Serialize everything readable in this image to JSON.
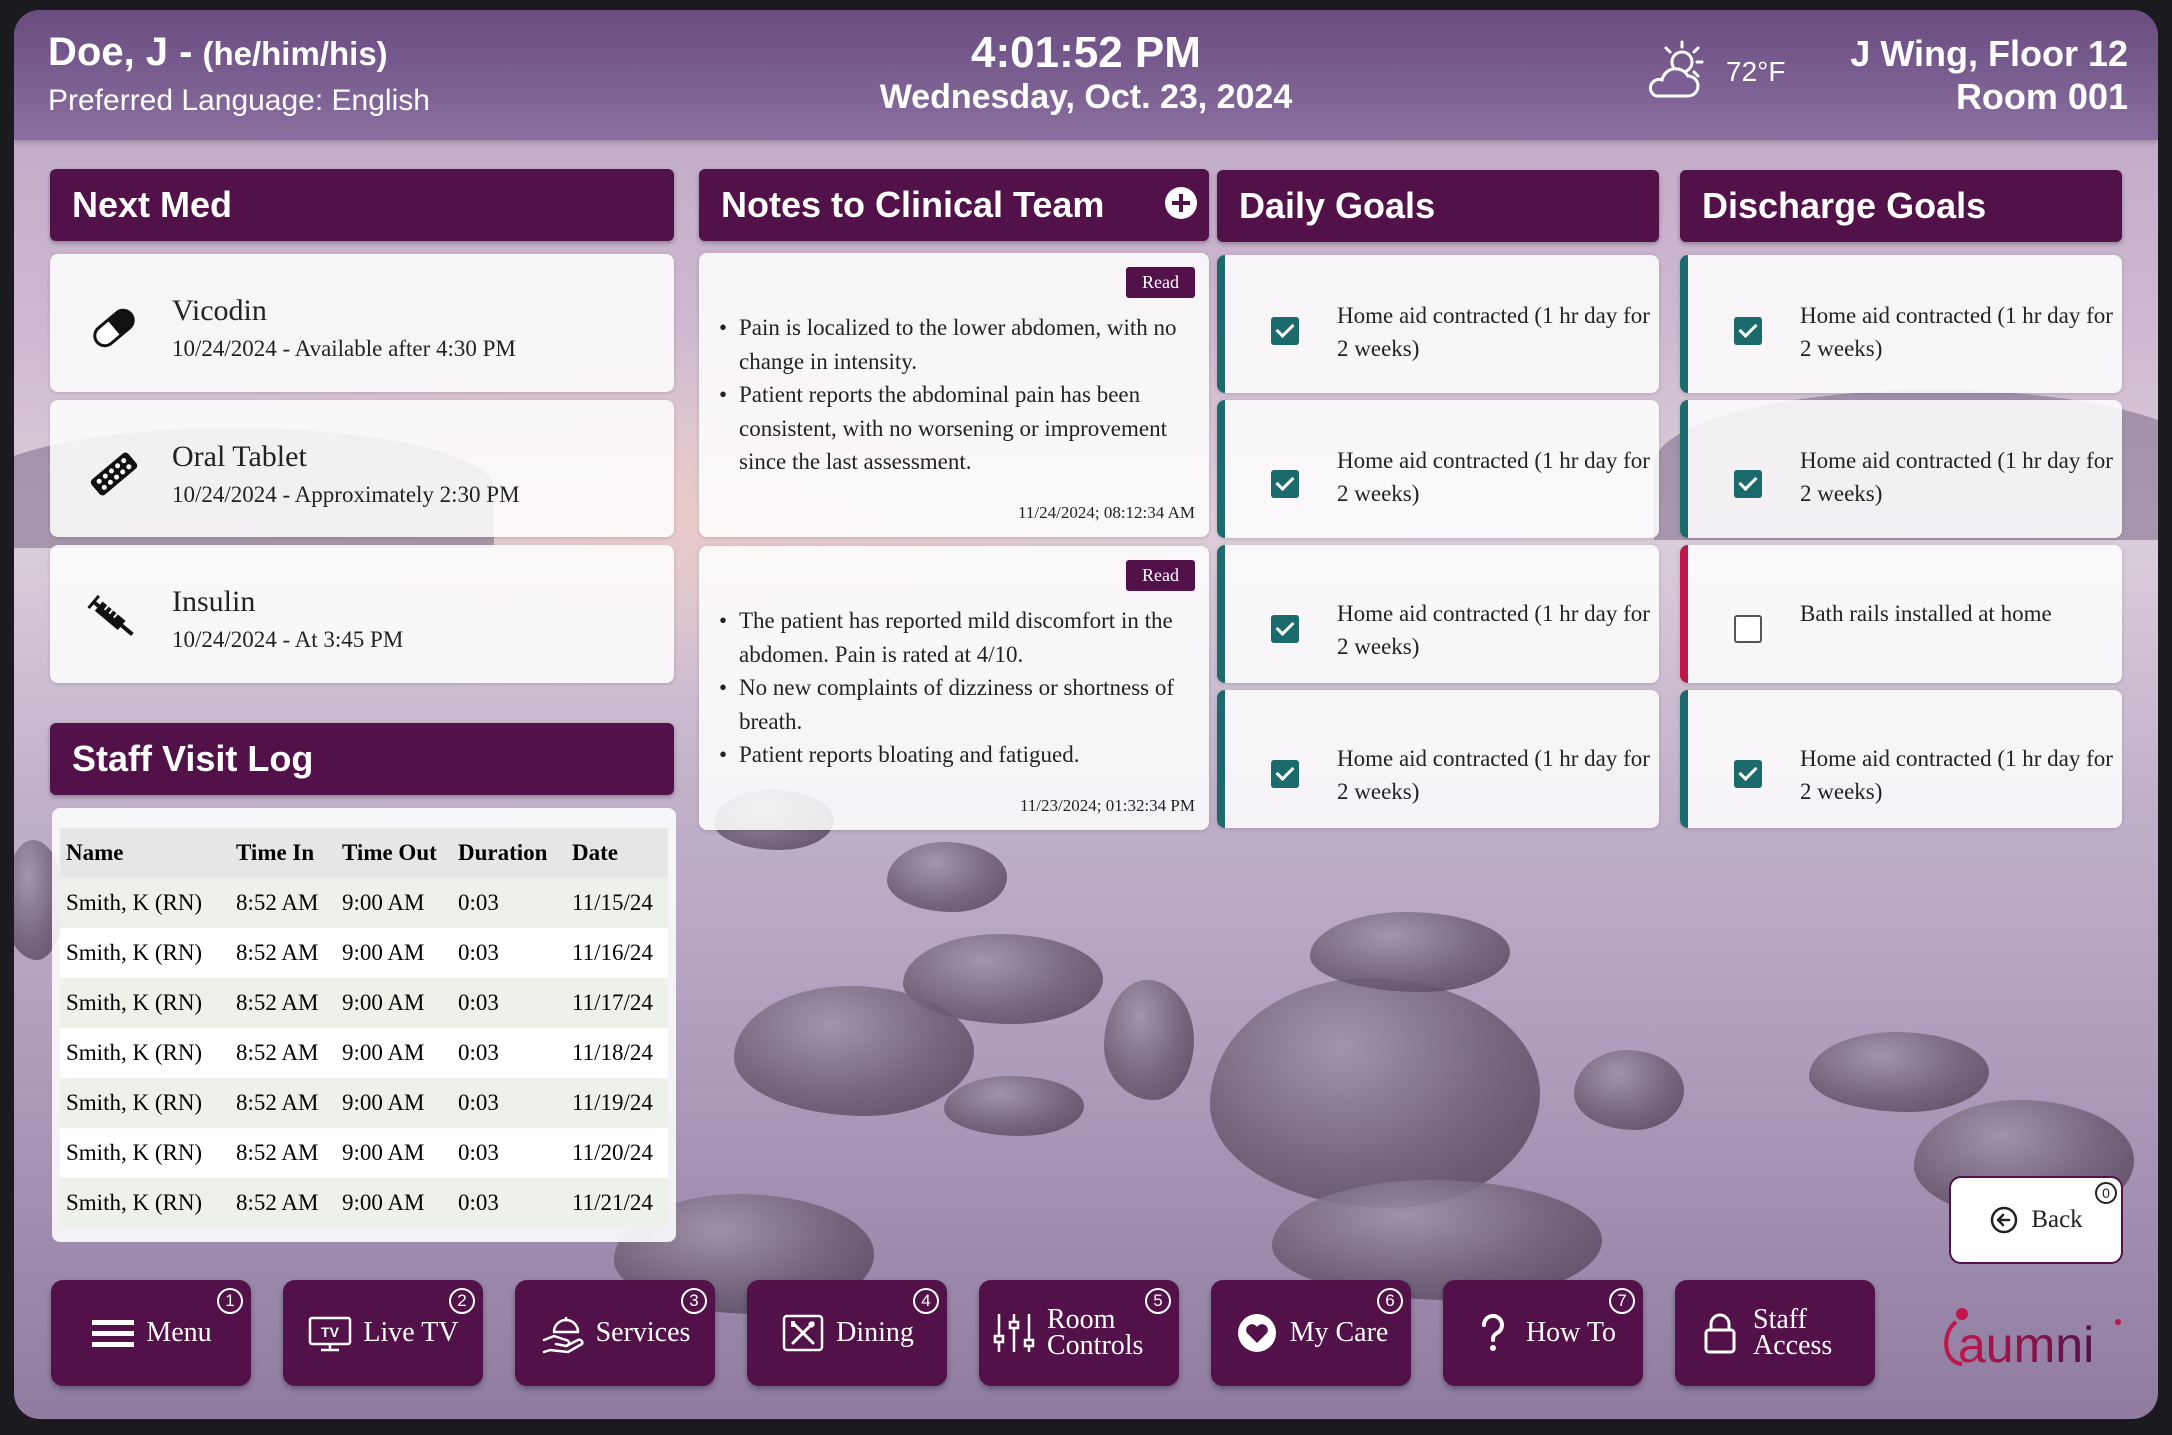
{
  "header": {
    "patient_name": "Doe, J -",
    "pronouns": "(he/him/his)",
    "preferred_language": "Preferred Language: English",
    "time": "4:01:52 PM",
    "date": "Wednesday, Oct. 23, 2024",
    "weather_icon": "partly-cloudy-icon",
    "temperature": "72°F",
    "location_line1": "J Wing, Floor 12",
    "location_line2": "Room 001"
  },
  "next_med": {
    "title": "Next Med",
    "items": [
      {
        "name": "Vicodin",
        "time": "10/24/2024 - Available after 4:30 PM",
        "icon": "pill-capsule-icon"
      },
      {
        "name": "Oral Tablet",
        "time": "10/24/2024 - Approximately 2:30 PM",
        "icon": "tablet-blister-icon"
      },
      {
        "name": "Insulin",
        "time": "10/24/2024 - At 3:45 PM",
        "icon": "syringe-icon"
      }
    ]
  },
  "notes": {
    "title": "Notes to Clinical Team",
    "add_icon": "add-circle-icon",
    "items": [
      {
        "badge": "Read",
        "bullets": [
          "Pain is localized to the lower abdomen, with no change in intensity.",
          "Patient reports the abdominal pain has been consistent, with no worsening or improvement since the last assessment."
        ],
        "timestamp": "11/24/2024; 08:12:34 AM"
      },
      {
        "badge": "Read",
        "bullets": [
          "The patient has reported mild discomfort in the abdomen. Pain is rated at 4/10.",
          "No new complaints of dizziness or shortness of breath.",
          "Patient reports bloating and fatigued."
        ],
        "timestamp": "11/23/2024; 01:32:34 PM"
      }
    ]
  },
  "daily_goals": {
    "title": "Daily Goals",
    "items": [
      {
        "text": "Home aid contracted (1 hr day for 2 weeks)",
        "checked": true
      },
      {
        "text": "Home aid contracted (1 hr day for 2 weeks)",
        "checked": true
      },
      {
        "text": "Home aid contracted (1 hr day for 2 weeks)",
        "checked": true
      },
      {
        "text": "Home aid contracted (1 hr day for 2 weeks)",
        "checked": true
      }
    ]
  },
  "discharge_goals": {
    "title": "Discharge Goals",
    "items": [
      {
        "text": "Home aid contracted (1 hr day for 2 weeks)",
        "checked": true
      },
      {
        "text": "Home aid contracted (1 hr day for 2 weeks)",
        "checked": true
      },
      {
        "text": "Bath rails installed at home",
        "checked": false
      },
      {
        "text": "Home aid contracted (1 hr day for 2 weeks)",
        "checked": true
      }
    ]
  },
  "staff_log": {
    "title": "Staff Visit Log",
    "columns": [
      "Name",
      "Time In",
      "Time Out",
      "Duration",
      "Date"
    ],
    "rows": [
      [
        "Smith, K (RN)",
        "8:52 AM",
        "9:00 AM",
        "0:03",
        "11/15/24"
      ],
      [
        "Smith, K (RN)",
        "8:52 AM",
        "9:00 AM",
        "0:03",
        "11/16/24"
      ],
      [
        "Smith, K (RN)",
        "8:52 AM",
        "9:00 AM",
        "0:03",
        "11/17/24"
      ],
      [
        "Smith, K (RN)",
        "8:52 AM",
        "9:00 AM",
        "0:03",
        "11/18/24"
      ],
      [
        "Smith, K (RN)",
        "8:52 AM",
        "9:00 AM",
        "0:03",
        "11/19/24"
      ],
      [
        "Smith, K (RN)",
        "8:52 AM",
        "9:00 AM",
        "0:03",
        "11/20/24"
      ],
      [
        "Smith, K (RN)",
        "8:52 AM",
        "9:00 AM",
        "0:03",
        "11/21/24"
      ]
    ]
  },
  "back": {
    "label": "Back",
    "shortcut": "0",
    "icon": "arrow-left-circle-icon"
  },
  "nav": [
    {
      "label": "Menu",
      "shortcut": "1",
      "icon": "hamburger-menu-icon"
    },
    {
      "label": "Live TV",
      "shortcut": "2",
      "icon": "tv-icon"
    },
    {
      "label": "Services",
      "shortcut": "3",
      "icon": "service-hand-icon"
    },
    {
      "label": "Dining",
      "shortcut": "4",
      "icon": "fork-knife-icon"
    },
    {
      "label": "Room Controls",
      "shortcut": "5",
      "icon": "sliders-icon"
    },
    {
      "label": "My Care",
      "shortcut": "6",
      "icon": "heart-icon"
    },
    {
      "label": "How To",
      "shortcut": "7",
      "icon": "question-icon"
    },
    {
      "label": "Staff Access",
      "shortcut": "",
      "icon": "lock-icon"
    }
  ],
  "logo": {
    "text": "aumni"
  },
  "colors": {
    "brand_purple": "#521148",
    "goal_done": "#1b6a6c",
    "goal_pending": "#c0164a"
  }
}
